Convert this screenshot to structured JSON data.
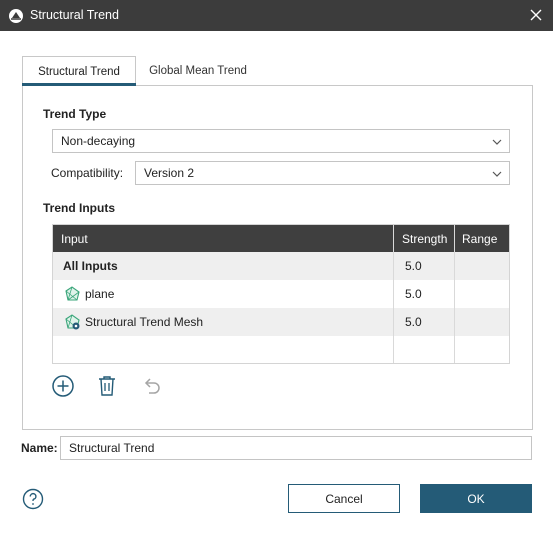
{
  "window": {
    "title": "Structural Trend",
    "app_icon": "leapfrog-app-icon",
    "close_icon": "close-icon"
  },
  "tabs": [
    {
      "label": "Structural Trend",
      "mnemonic_index": 6,
      "active": true
    },
    {
      "label": "Global Mean Trend",
      "mnemonic_index": 12,
      "active": false
    }
  ],
  "trend_type": {
    "label": "Trend Type",
    "mnemonic_index": 9,
    "value": "Non-decaying"
  },
  "compatibility": {
    "label": "Compatibility:",
    "mnemonic_index": 12,
    "value": "Version 2"
  },
  "trend_inputs": {
    "label": "Trend Inputs",
    "columns": [
      "Input",
      "Strength",
      "Range"
    ],
    "rows": [
      {
        "input": "All Inputs",
        "strength": "5.0",
        "range": "",
        "bold": true,
        "icon": ""
      },
      {
        "input": "plane",
        "strength": "5.0",
        "range": "",
        "bold": false,
        "icon": "plane-mesh-icon"
      },
      {
        "input": "Structural Trend Mesh",
        "strength": "5.0",
        "range": "",
        "bold": false,
        "icon": "trend-mesh-icon"
      }
    ]
  },
  "actions": {
    "add": "add-circle-icon",
    "delete": "trash-icon",
    "undo": "undo-icon"
  },
  "name_field": {
    "label": "Name:",
    "value": "Structural Trend"
  },
  "buttons": {
    "cancel": "Cancel",
    "ok": "OK"
  },
  "colors": {
    "accent": "#245b77",
    "titlebar": "#3c3c3c",
    "grid_header": "#3f3f3f",
    "mesh_green": "#3aa57a"
  }
}
